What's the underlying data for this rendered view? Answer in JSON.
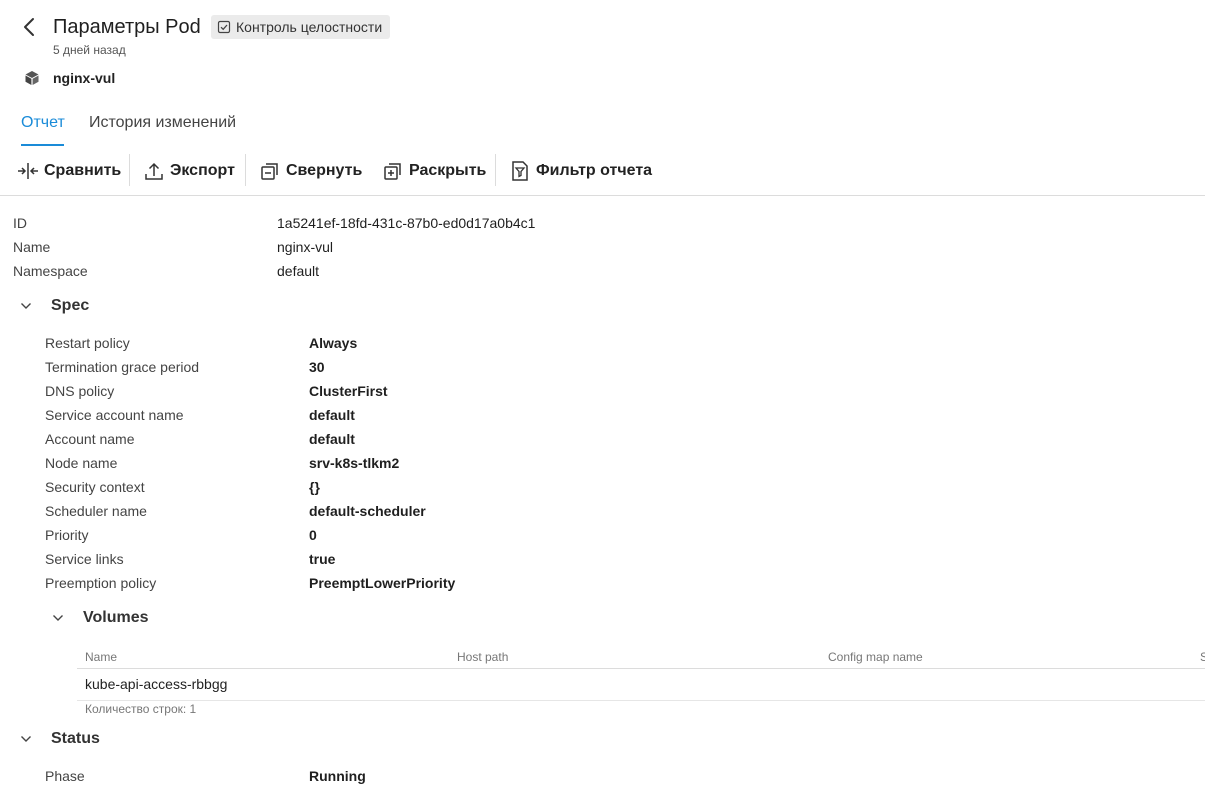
{
  "header": {
    "title": "Параметры Pod",
    "badge": "Контроль целостности",
    "subtitle": "5 дней назад",
    "resource_name": "nginx-vul"
  },
  "tabs": [
    {
      "label": "Отчет",
      "active": true
    },
    {
      "label": "История изменений",
      "active": false
    }
  ],
  "toolbar": {
    "compare": "Сравнить",
    "export": "Экспорт",
    "collapse": "Свернуть",
    "expand": "Раскрыть",
    "filter": "Фильтр отчета"
  },
  "general": [
    {
      "key": "ID",
      "value": "1a5241ef-18fd-431c-87b0-ed0d17a0b4c1"
    },
    {
      "key": "Name",
      "value": "nginx-vul"
    },
    {
      "key": "Namespace",
      "value": "default"
    }
  ],
  "spec": {
    "title": "Spec",
    "rows": [
      {
        "key": "Restart policy",
        "value": "Always"
      },
      {
        "key": "Termination grace period",
        "value": "30"
      },
      {
        "key": "DNS policy",
        "value": "ClusterFirst"
      },
      {
        "key": "Service account name",
        "value": "default"
      },
      {
        "key": "Account name",
        "value": "default"
      },
      {
        "key": "Node name",
        "value": "srv-k8s-tlkm2"
      },
      {
        "key": "Security context",
        "value": "{}"
      },
      {
        "key": "Scheduler name",
        "value": "default-scheduler"
      },
      {
        "key": "Priority",
        "value": "0"
      },
      {
        "key": "Service links",
        "value": "true"
      },
      {
        "key": "Preemption policy",
        "value": "PreemptLowerPriority"
      }
    ]
  },
  "volumes": {
    "title": "Volumes",
    "columns": [
      "Name",
      "Host path",
      "Config map name",
      "S"
    ],
    "rows": [
      [
        "kube-api-access-rbbgg",
        "",
        "",
        ""
      ]
    ],
    "row_count": "Количество строк: 1"
  },
  "status": {
    "title": "Status",
    "rows": [
      {
        "key": "Phase",
        "value": "Running"
      }
    ]
  },
  "colors": {
    "accent": "#1a8bd8",
    "badge_bg": "#ebebeb",
    "divider": "#dcdcdc"
  }
}
